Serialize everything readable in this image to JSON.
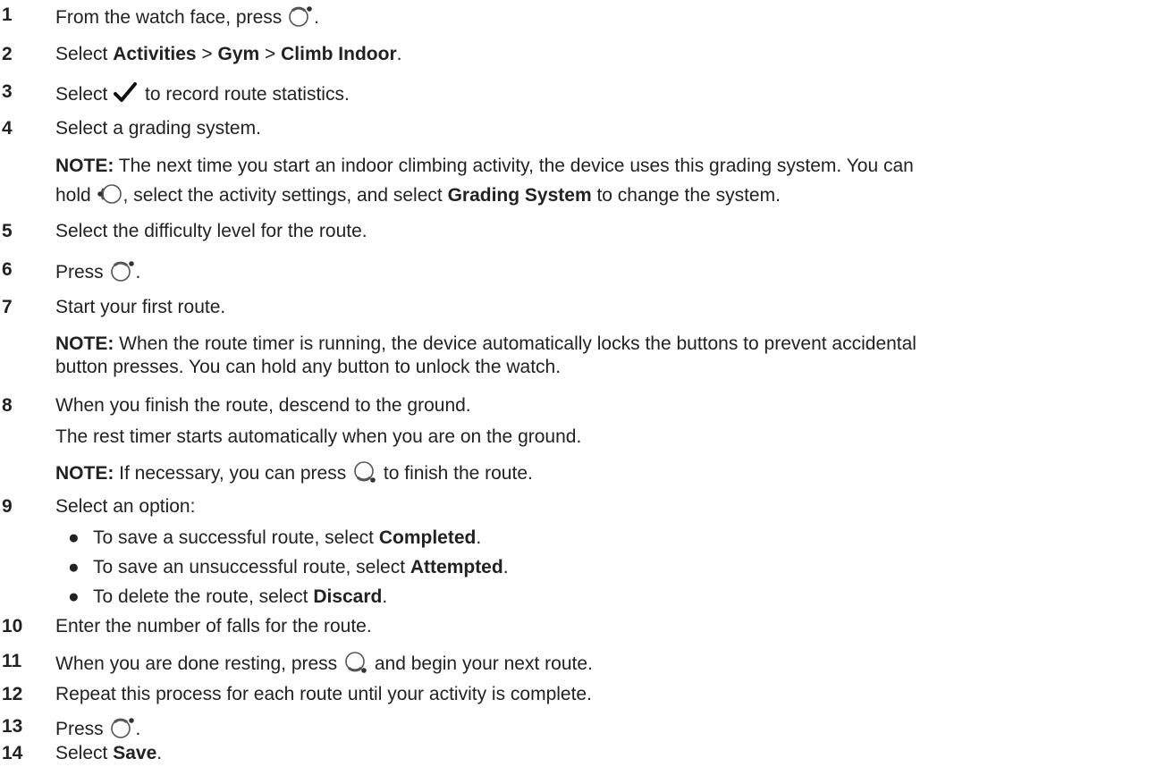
{
  "steps": [
    {
      "num": "1",
      "a": "From the watch face, press ",
      "icon": "start-stop-button-icon",
      "b": "."
    },
    {
      "num": "2",
      "a": "Select ",
      "b1": "Activities",
      "s1": " > ",
      "b2": "Gym",
      "s2": " > ",
      "b3": "Climb Indoor",
      "end": "."
    },
    {
      "num": "3",
      "a": "Select ",
      "icon": "checkmark-icon",
      "b": " to record route statistics."
    },
    {
      "num": "4",
      "a": "Select a grading system."
    },
    {
      "note_label": "NOTE:",
      "a": " The next time you start an indoor climbing activity, the device uses this grading system. You can",
      "l2a": "hold ",
      "icon": "menu-button-icon",
      "l2b": ", select the activity settings, and select ",
      "bold": "Grading System",
      "l2c": " to change the system."
    },
    {
      "num": "5",
      "a": "Select the difficulty level for the route."
    },
    {
      "num": "6",
      "a": "Press ",
      "icon": "start-stop-button-icon",
      "b": "."
    },
    {
      "num": "7",
      "a": "Start your first route."
    },
    {
      "note_label": "NOTE:",
      "a": " When the route timer is running, the device automatically locks the buttons to prevent accidental",
      "l2": "button presses. You can hold any button to unlock the watch."
    },
    {
      "num": "8",
      "a": "When you finish the route, descend to the ground."
    },
    {
      "a": "The rest timer starts automatically when you are on the ground."
    },
    {
      "note_label": "NOTE:",
      "a": " If necessary, you can press ",
      "icon": "back-lap-button-icon",
      "b": " to finish the route."
    },
    {
      "num": "9",
      "a": "Select an option:"
    },
    {
      "bullet": "●",
      "a": "To save a successful route, select ",
      "bold": "Completed",
      "b": "."
    },
    {
      "bullet": "●",
      "a": "To save an unsuccessful route, select ",
      "bold": "Attempted",
      "b": "."
    },
    {
      "bullet": "●",
      "a": "To delete the route, select ",
      "bold": "Discard",
      "b": "."
    },
    {
      "num": "10",
      "a": "Enter the number of falls for the route."
    },
    {
      "num": "11",
      "a": "When you are done resting, press ",
      "icon": "back-lap-button-icon",
      "b": " and begin your next route."
    },
    {
      "num": "12",
      "a": "Repeat this process for each route until your activity is complete."
    },
    {
      "num": "13",
      "a": "Press ",
      "icon": "start-stop-button-icon",
      "b": "."
    },
    {
      "num": "14",
      "a": "Select ",
      "bold": "Save",
      "b": "."
    }
  ]
}
